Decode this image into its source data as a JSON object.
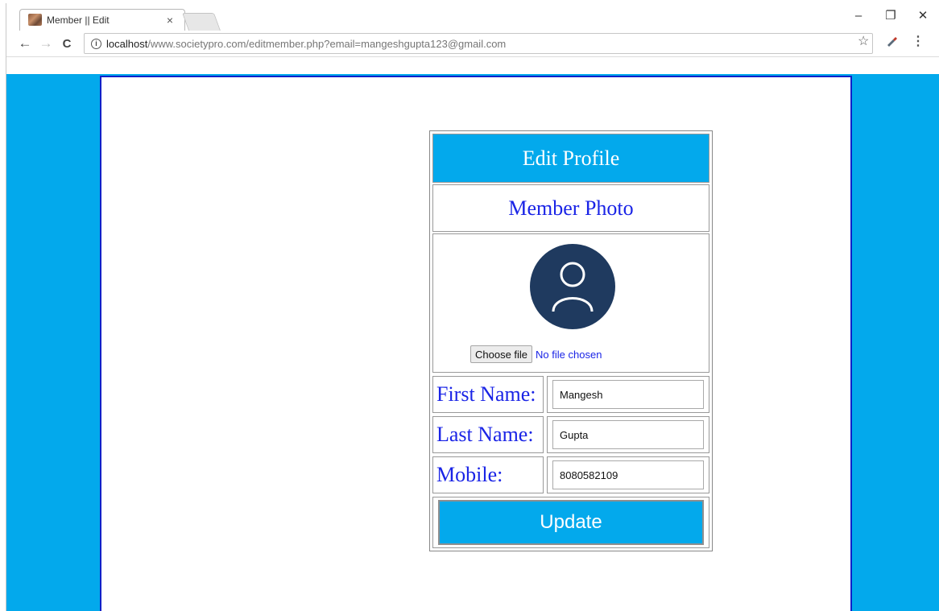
{
  "browser": {
    "tab_title": "Member || Edit",
    "tab_close": "×",
    "url_host": "localhost",
    "url_rest": "/www.societypro.com/editmember.php?email=mangeshgupta123@gmail.com",
    "back_glyph": "←",
    "forward_glyph": "→",
    "reload_glyph": "C",
    "info_glyph": "i",
    "star_glyph": "☆",
    "menu_glyph": "⋮",
    "minimize_glyph": "–",
    "restore_glyph": "❐",
    "close_glyph": "✕"
  },
  "form": {
    "header": "Edit Profile",
    "photo_title": "Member Photo",
    "file_button": "Choose file",
    "file_status": "No file chosen",
    "fields": [
      {
        "label": "First Name:",
        "value": "Mangesh"
      },
      {
        "label": "Last Name:",
        "value": "Gupta"
      },
      {
        "label": "Mobile:",
        "value": "8080582109"
      }
    ],
    "submit_label": "Update"
  },
  "colors": {
    "page_accent": "#03a9ec",
    "label_blue": "#1a24e6",
    "avatar_bg": "#1f3a5f",
    "panel_border": "#1020c8"
  },
  "icons": {
    "avatar": "user-avatar-icon",
    "favicon": "site-favicon-icon"
  }
}
